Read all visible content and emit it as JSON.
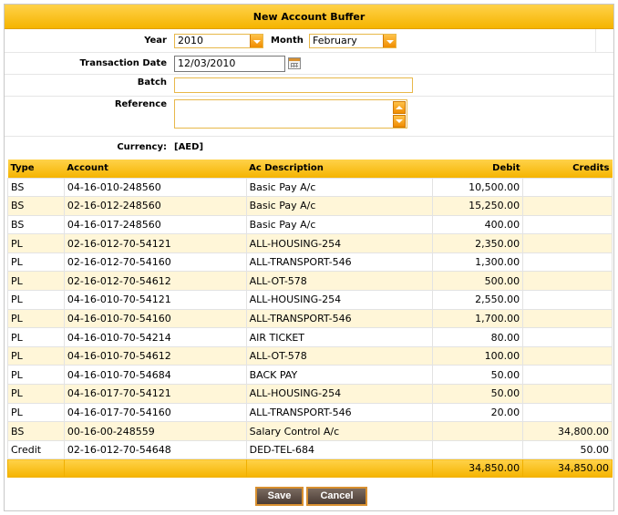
{
  "title": "New Account Buffer",
  "form": {
    "year_label": "Year",
    "year_value": "2010",
    "month_label": "Month",
    "month_value": "February",
    "transaction_date_label": "Transaction Date",
    "transaction_date_value": "12/03/2010",
    "batch_label": "Batch",
    "batch_value": "",
    "reference_label": "Reference",
    "reference_value": "",
    "currency_label": "Currency:",
    "currency_value": "[AED]"
  },
  "table": {
    "headers": {
      "type": "Type",
      "account": "Account",
      "description": "Ac Description",
      "debit": "Debit",
      "credits": "Credits"
    },
    "rows": [
      {
        "type": "BS",
        "account": "04-16-010-248560",
        "description": "Basic Pay A/c",
        "debit": "10,500.00",
        "credit": ""
      },
      {
        "type": "BS",
        "account": "02-16-012-248560",
        "description": "Basic Pay A/c",
        "debit": "15,250.00",
        "credit": ""
      },
      {
        "type": "BS",
        "account": "04-16-017-248560",
        "description": "Basic Pay A/c",
        "debit": "400.00",
        "credit": ""
      },
      {
        "type": "PL",
        "account": "02-16-012-70-54121",
        "description": "ALL-HOUSING-254",
        "debit": "2,350.00",
        "credit": ""
      },
      {
        "type": "PL",
        "account": "02-16-012-70-54160",
        "description": "ALL-TRANSPORT-546",
        "debit": "1,300.00",
        "credit": ""
      },
      {
        "type": "PL",
        "account": "02-16-012-70-54612",
        "description": "ALL-OT-578",
        "debit": "500.00",
        "credit": ""
      },
      {
        "type": "PL",
        "account": "04-16-010-70-54121",
        "description": "ALL-HOUSING-254",
        "debit": "2,550.00",
        "credit": ""
      },
      {
        "type": "PL",
        "account": "04-16-010-70-54160",
        "description": "ALL-TRANSPORT-546",
        "debit": "1,700.00",
        "credit": ""
      },
      {
        "type": "PL",
        "account": "04-16-010-70-54214",
        "description": "AIR TICKET",
        "debit": "80.00",
        "credit": ""
      },
      {
        "type": "PL",
        "account": "04-16-010-70-54612",
        "description": "ALL-OT-578",
        "debit": "100.00",
        "credit": ""
      },
      {
        "type": "PL",
        "account": "04-16-010-70-54684",
        "description": "BACK PAY",
        "debit": "50.00",
        "credit": ""
      },
      {
        "type": "PL",
        "account": "04-16-017-70-54121",
        "description": "ALL-HOUSING-254",
        "debit": "50.00",
        "credit": ""
      },
      {
        "type": "PL",
        "account": "04-16-017-70-54160",
        "description": "ALL-TRANSPORT-546",
        "debit": "20.00",
        "credit": ""
      },
      {
        "type": "BS",
        "account": "00-16-00-248559",
        "description": "Salary Control A/c",
        "debit": "",
        "credit": "34,800.00"
      },
      {
        "type": "Credit",
        "account": "02-16-012-70-54648",
        "description": "DED-TEL-684",
        "debit": "",
        "credit": "50.00"
      }
    ],
    "total_debit": "34,850.00",
    "total_credit": "34,850.00"
  },
  "buttons": {
    "save": "Save",
    "cancel": "Cancel"
  },
  "icons": {
    "calendar": "calendar-icon",
    "dropdown": "chevron-down-icon"
  }
}
